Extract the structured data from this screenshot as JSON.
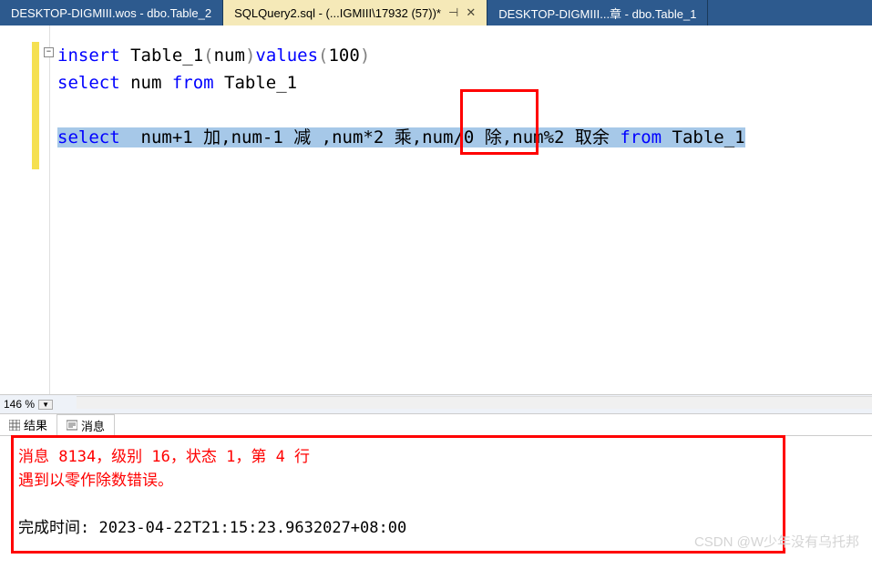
{
  "tabs": [
    {
      "label": "DESKTOP-DIGMIII.wos - dbo.Table_2",
      "active": false
    },
    {
      "label": "SQLQuery2.sql - (...IGMIII\\17932 (57))*",
      "active": true
    },
    {
      "label": "DESKTOP-DIGMIII...章 - dbo.Table_1",
      "active": false
    }
  ],
  "code": {
    "line1": {
      "kw1": "insert",
      "t1": " Table_1",
      "p1": "(",
      "t2": "num",
      "p2": ")",
      "kw2": "values",
      "p3": "(",
      "n1": "100",
      "p4": ")"
    },
    "line2": {
      "kw1": "select",
      "t1": " num ",
      "kw2": "from",
      "t2": " Table_1"
    },
    "line4": {
      "kw1": "select",
      "seg": "  num+1 加,num-1 减 ,num*2 乘,num/0 除,num%2 取余 ",
      "kw2": "from",
      "t2": " Table_1"
    }
  },
  "zoom": {
    "value": "146 %"
  },
  "resultTabs": {
    "results": "结果",
    "messages": "消息"
  },
  "messages": {
    "err1": "消息 8134，级别 16，状态 1，第 4 行",
    "err2": "遇到以零作除数错误。",
    "done": "完成时间: 2023-04-22T21:15:23.9632027+08:00"
  },
  "watermark": "CSDN @W少年没有乌托邦",
  "icons": {
    "pin": "⊣",
    "close": "✕",
    "collapse": "−",
    "dropdown": "▼"
  }
}
